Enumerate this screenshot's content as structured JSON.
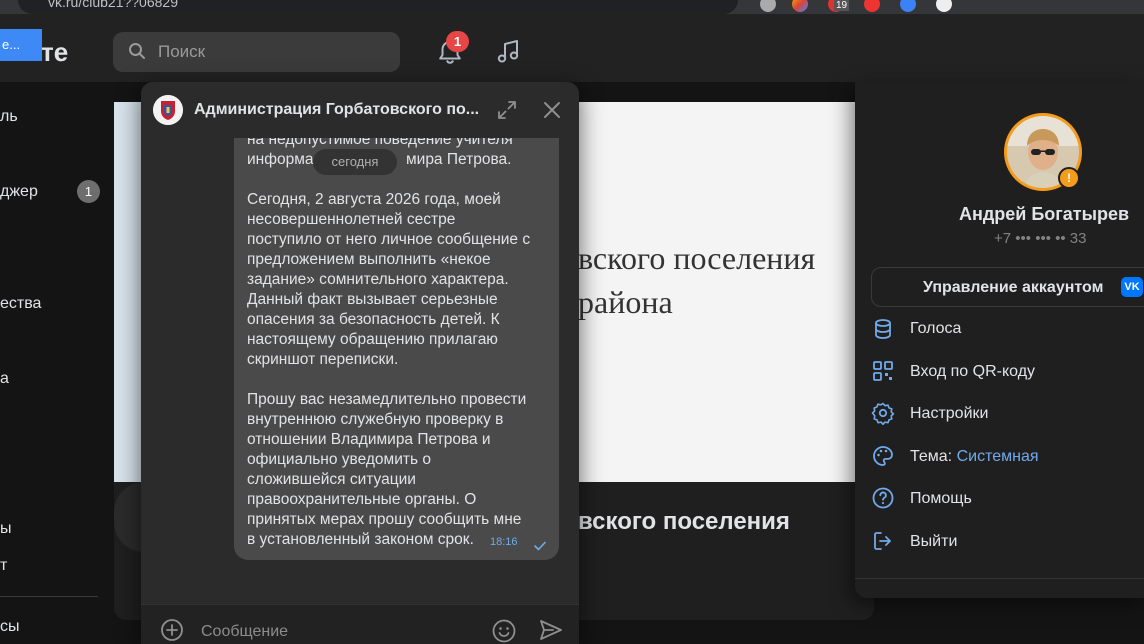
{
  "browser": {
    "url": "vk.ru/club21??06829",
    "extension_badge": "19"
  },
  "header": {
    "logo_partial": "кте",
    "tooltip_partial": "е...",
    "search_placeholder": "Поиск",
    "notification_count": "1"
  },
  "sidebar": {
    "items": [
      "ль",
      "джер",
      "",
      "",
      "ества",
      "а",
      "ы",
      "т",
      "сы"
    ],
    "messenger_counter": "1"
  },
  "background_post": {
    "doc_line1": "вского поселения",
    "doc_line2": "района",
    "title_partial": "вского поселения"
  },
  "chat": {
    "title": "Администрация Горбатовского по...",
    "date_separator": "сегодня",
    "message_lines_top": [
      "на недопустимое поведение учителя",
      "информа",
      "мира Петрова."
    ],
    "message_lines": [
      "Сегодня, 2 августа 2026 года, моей",
      "несовершеннолетней сестре",
      "поступило от него личное сообщение с",
      "предложением выполнить «некое",
      "задание» сомнительного характера.",
      "Данный факт вызывает серьезные",
      "опасения за безопасность детей. К",
      "настоящему обращению прилагаю",
      "скриншот переписки.",
      "",
      "Прошу вас незамедлительно провести",
      "внутреннюю служебную проверку в",
      "отношении Владимира Петрова и",
      "официально уведомить о",
      "сложившейся ситуации",
      "правоохранительные органы. О",
      "принятых мерах прошу сообщить мне",
      "в установленный законом срок."
    ],
    "message_time": "18:16",
    "input_placeholder": "Сообщение"
  },
  "profile": {
    "name": "Андрей Богатырев",
    "phone": "+7 ••• ••• •• 33",
    "manage_label": "Управление аккаунтом",
    "vk_badge": "VK",
    "menu": [
      {
        "icon": "coins-icon",
        "label": "Голоса"
      },
      {
        "icon": "qr-code-icon",
        "label": "Вход по QR-коду"
      },
      {
        "icon": "gear-icon",
        "label": "Настройки"
      },
      {
        "icon": "palette-icon",
        "label": "Тема:",
        "value": "Системная"
      },
      {
        "icon": "help-icon",
        "label": "Помощь"
      },
      {
        "icon": "logout-icon",
        "label": "Выйти"
      }
    ]
  },
  "colors": {
    "accent": "#71aaeb",
    "notification": "#e64646",
    "avatar_ring": "#f59c1a",
    "bubble": "#4a4a4a"
  }
}
